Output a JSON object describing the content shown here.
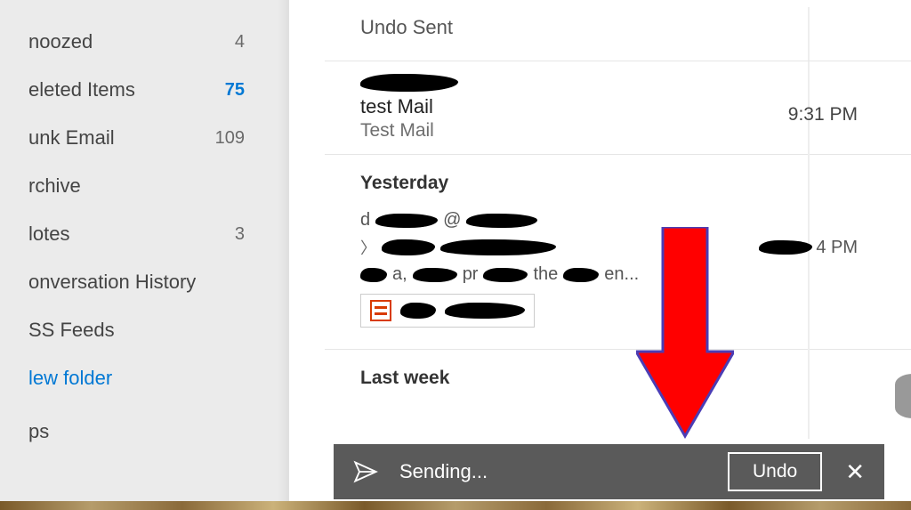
{
  "sidebar": {
    "items": [
      {
        "label": "noozed",
        "count": "4"
      },
      {
        "label": "eleted Items",
        "count": "75"
      },
      {
        "label": "unk Email",
        "count": "109"
      },
      {
        "label": "rchive",
        "count": ""
      },
      {
        "label": "lotes",
        "count": "3"
      },
      {
        "label": "onversation History",
        "count": ""
      },
      {
        "label": "SS Feeds",
        "count": ""
      }
    ],
    "new_folder": "lew folder",
    "no_prefix": "ps"
  },
  "undo_sent_label": "Undo Sent",
  "email1": {
    "subject": "test Mail",
    "preview": "Test Mail",
    "time": "9:31 PM"
  },
  "sections": {
    "yesterday": "Yesterday",
    "lastweek": "Last week"
  },
  "email2": {
    "time_visible": "4 PM",
    "preview_suffix": "en..."
  },
  "toast": {
    "sending": "Sending...",
    "undo": "Undo"
  }
}
